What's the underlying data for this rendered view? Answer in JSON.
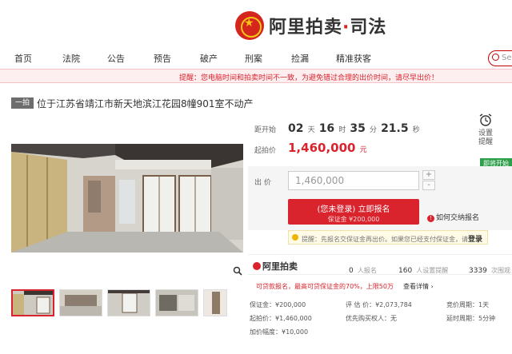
{
  "brand": {
    "name_a": "阿里拍卖",
    "sep": "·",
    "name_b": "司法"
  },
  "nav": {
    "items": [
      "首页",
      "法院",
      "公告",
      "预告",
      "破产",
      "刑案",
      "捡漏",
      "精准获客"
    ],
    "search_placeholder": "Sear"
  },
  "notice": "提醒：您电脑时间和拍卖时间不一致，为避免错过合理的出价时间，请尽早出价！",
  "lot": {
    "tag": "一拍",
    "title": "位于江苏省靖江市新天地滨江花园8幢901室不动产"
  },
  "countdown": {
    "label": "距开始",
    "days": "02",
    "days_unit": "天",
    "hours": "16",
    "hours_unit": "时",
    "minutes": "35",
    "minutes_unit": "分",
    "seconds": "21.5",
    "seconds_unit": "秒"
  },
  "remind": {
    "line1": "设置",
    "line2": "提醒"
  },
  "start_price": {
    "label": "起拍价",
    "value": "1,460,000",
    "unit": "元"
  },
  "status_badge": "即将开始",
  "bid": {
    "label": "出 价",
    "value": "1,460,000",
    "plus": "+",
    "minus": "-"
  },
  "register": {
    "line1": "(您未登录) 立即报名",
    "line2": "保证金 ¥200,000"
  },
  "how_to_pay": "如何交纳报名",
  "tip": {
    "text": "提醒：先报名交保证金再出价。如果您已经支付保证金，请",
    "link": "登录"
  },
  "stats": {
    "logo": "阿里拍卖",
    "signups": "0",
    "signups_label": "人报名",
    "reminders": "160",
    "reminders_label": "人设置提醒",
    "views": "3339",
    "views_label": "次围观"
  },
  "extra": {
    "text": "可贷款报名，最高可贷保证金的70%，上限50万",
    "detail": "查看详情"
  },
  "info": {
    "deposit": "保证金：¥200,000",
    "appraisal": "评 估 价：¥2,073,784",
    "cycle": "竞价周期：1天",
    "start": "起拍价：¥1,460,000",
    "priority": "优先购买权人：无",
    "delay": "延时周期：5分钟",
    "increment": "加价幅度：¥10,000"
  },
  "colors": {
    "accent": "#d9232d",
    "green": "#2d9e4a"
  }
}
